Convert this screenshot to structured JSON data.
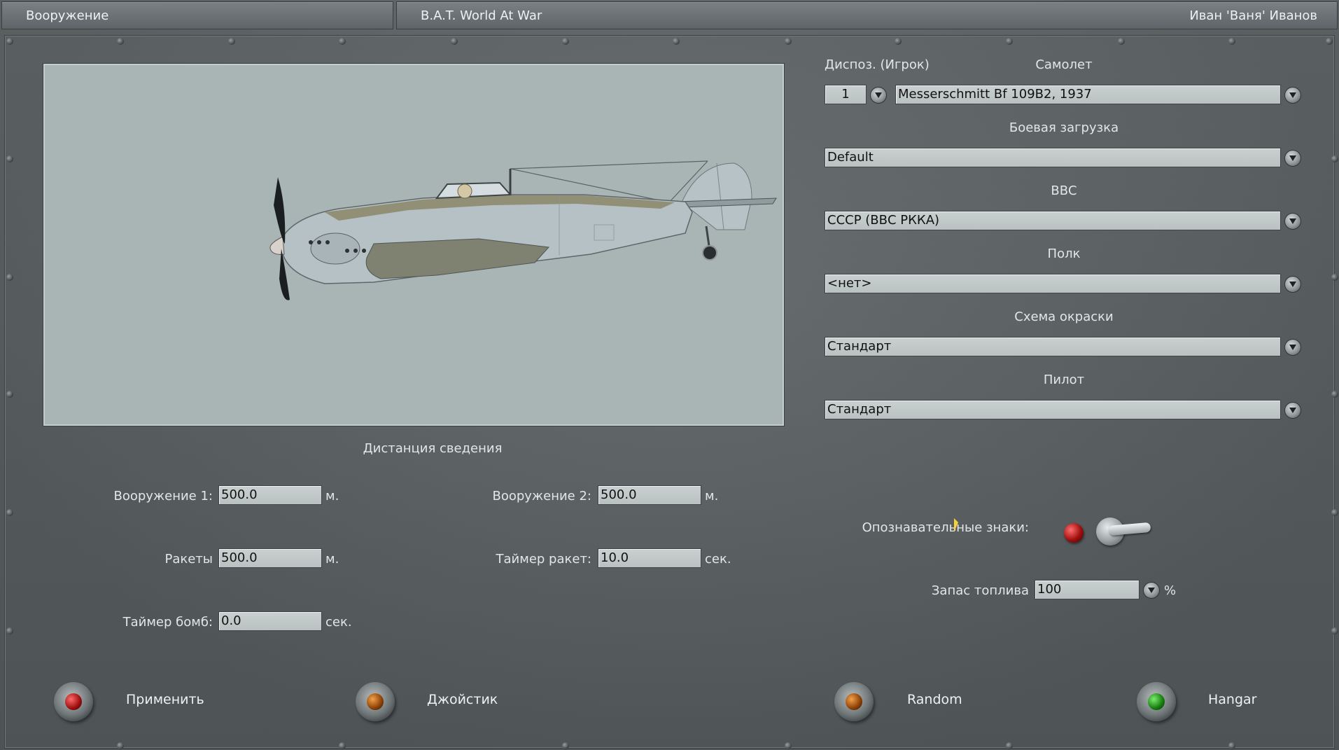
{
  "window": {
    "section_title": "Вооружение",
    "app_title": "B.A.T. World At War",
    "user_name": "Иван 'Ваня' Иванов"
  },
  "preview": {
    "aircraft_icon": "aircraft-preview-image"
  },
  "selection": {
    "dispos_label": "Диспоз. (Игрок)",
    "dispos_value": "1",
    "aircraft_label": "Самолет",
    "aircraft_value": "Messerschmitt Bf 109B2, 1937",
    "loadout_label": "Боевая загрузка",
    "loadout_value": "Default",
    "airforce_label": "ВВС",
    "airforce_value": "СССР (ВВС РККА)",
    "regiment_label": "Полк",
    "regiment_value": "<нет>",
    "skin_label": "Схема окраски",
    "skin_value": "Стандарт",
    "pilot_label": "Пилот",
    "pilot_value": "Стандарт"
  },
  "convergence": {
    "title": "Дистанция сведения",
    "weapon1_label": "Вооружение 1:",
    "weapon1_value": "500.0",
    "weapon1_unit": "м.",
    "weapon2_label": "Вооружение 2:",
    "weapon2_value": "500.0",
    "weapon2_unit": "м.",
    "rockets_label": "Ракеты",
    "rockets_value": "500.0",
    "rockets_unit": "м.",
    "rocket_timer_label": "Таймер ракет:",
    "rocket_timer_value": "10.0",
    "rocket_timer_unit": "сек.",
    "bomb_timer_label": "Таймер бомб:",
    "bomb_timer_value": "0.0",
    "bomb_timer_unit": "сек."
  },
  "markings": {
    "label": "Опознавательные знаки:",
    "enabled": false
  },
  "fuel": {
    "label": "Запас топлива",
    "value": "100",
    "unit": "%"
  },
  "buttons": {
    "apply": "Применить",
    "joystick": "Джойстик",
    "random": "Random",
    "hangar": "Hangar"
  },
  "colors": {
    "panel": "#5c6264",
    "field": "#c3caca",
    "preview_bg": "#a9b5b5",
    "lamp_red": "#9b0d0d",
    "lamp_amber": "#8a3f06",
    "lamp_green": "#167a0d"
  }
}
